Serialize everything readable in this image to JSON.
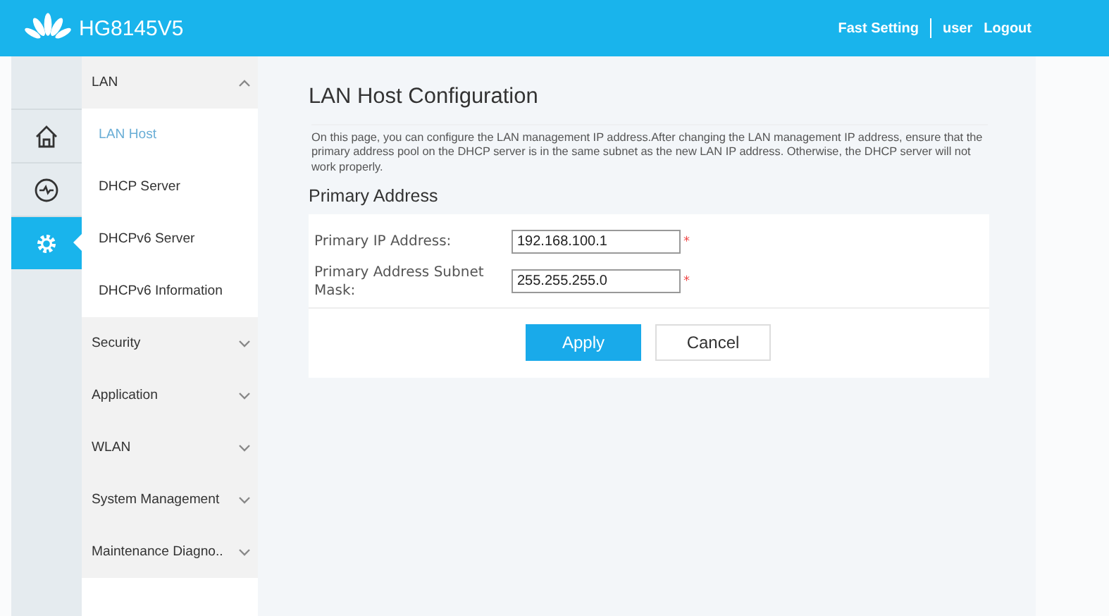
{
  "header": {
    "product": "HG8145V5",
    "links": [
      "Fast Setting",
      "user",
      "Logout"
    ]
  },
  "rail": [
    {
      "kind": "home",
      "selected": false
    },
    {
      "kind": "activity",
      "selected": false
    },
    {
      "kind": "settings",
      "selected": true
    }
  ],
  "menu": [
    {
      "label": "LAN",
      "expanded": true,
      "children": [
        {
          "label": "LAN Host",
          "selected": true
        },
        {
          "label": "DHCP Server",
          "selected": false
        },
        {
          "label": "DHCPv6 Server",
          "selected": false
        },
        {
          "label": "DHCPv6 Information",
          "selected": false
        }
      ]
    },
    {
      "label": "Security",
      "expanded": false
    },
    {
      "label": "Application",
      "expanded": false
    },
    {
      "label": "WLAN",
      "expanded": false
    },
    {
      "label": "System Management",
      "expanded": false
    },
    {
      "label": "Maintenance Diagno..",
      "expanded": false
    }
  ],
  "page": {
    "title": "LAN Host Configuration",
    "description": "On this page, you can configure the LAN management IP address.After changing the LAN management IP address, ensure that the primary address pool on the DHCP server is in the same subnet as the new LAN IP address. Otherwise, the DHCP server will not work properly.",
    "section": "Primary Address",
    "fields": [
      {
        "label": "Primary IP Address:",
        "value": "192.168.100.1",
        "required_mark": "*"
      },
      {
        "label": "Primary Address Subnet Mask:",
        "value": "255.255.255.0",
        "required_mark": "*"
      }
    ],
    "buttons": [
      {
        "label": "Apply",
        "kind": "primary"
      },
      {
        "label": "Cancel",
        "kind": "secondary"
      }
    ]
  }
}
